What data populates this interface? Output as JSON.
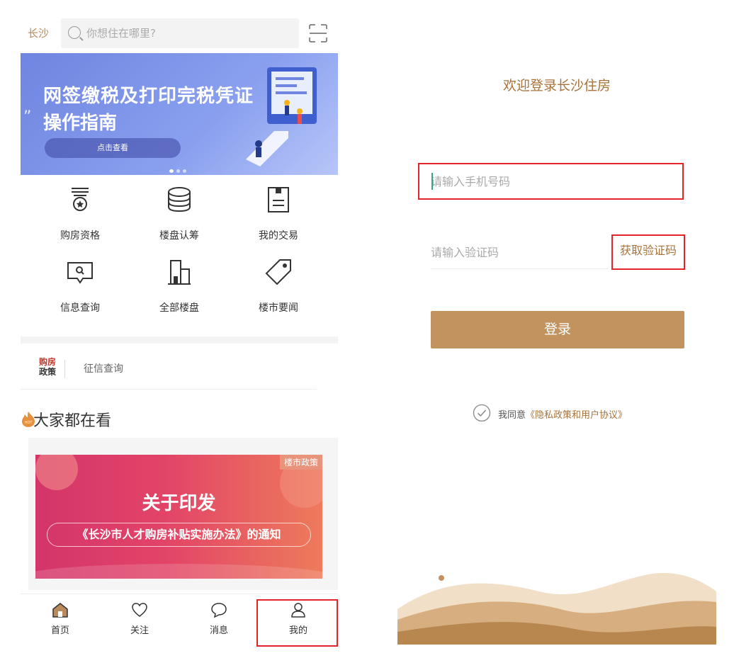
{
  "home": {
    "city": "长沙",
    "search_placeholder": "你想住在哪里?",
    "banner": {
      "line1": "网签缴税及打印完税凭证",
      "line2": "操作指南",
      "cta": "点击查看"
    },
    "grid": [
      {
        "label": "购房资格",
        "icon": "qualification-medal-icon"
      },
      {
        "label": "楼盘认筹",
        "icon": "coin-stack-icon"
      },
      {
        "label": "我的交易",
        "icon": "document-icon"
      },
      {
        "label": "信息查询",
        "icon": "info-search-icon"
      },
      {
        "label": "全部楼盘",
        "icon": "buildings-icon"
      },
      {
        "label": "楼市要闻",
        "icon": "price-tag-icon"
      }
    ],
    "policy": {
      "logo_line1": "购房",
      "logo_line2": "政策",
      "link": "征信查询"
    },
    "hot": {
      "title": "大家都在看",
      "icon_badge": "HOT"
    },
    "news": {
      "tag": "楼市政策",
      "title": "关于印发",
      "subtitle": "《长沙市人才购房补贴实施办法》的通知"
    },
    "tabs": [
      {
        "label": "首页",
        "icon": "home-icon"
      },
      {
        "label": "关注",
        "icon": "heart-icon"
      },
      {
        "label": "消息",
        "icon": "chat-bubble-icon"
      },
      {
        "label": "我的",
        "icon": "user-icon"
      }
    ]
  },
  "login": {
    "welcome": "欢迎登录长沙住房",
    "phone_placeholder": "请输入手机号码",
    "code_placeholder": "请输入验证码",
    "get_code": "获取验证码",
    "login_button": "登录",
    "agree_prefix": "我同意",
    "agree_link": "《隐私政策和用户协议》"
  },
  "colors": {
    "accent_gold": "#c2935f",
    "text_gold": "#a7733b",
    "highlight_red": "#e3222a"
  }
}
